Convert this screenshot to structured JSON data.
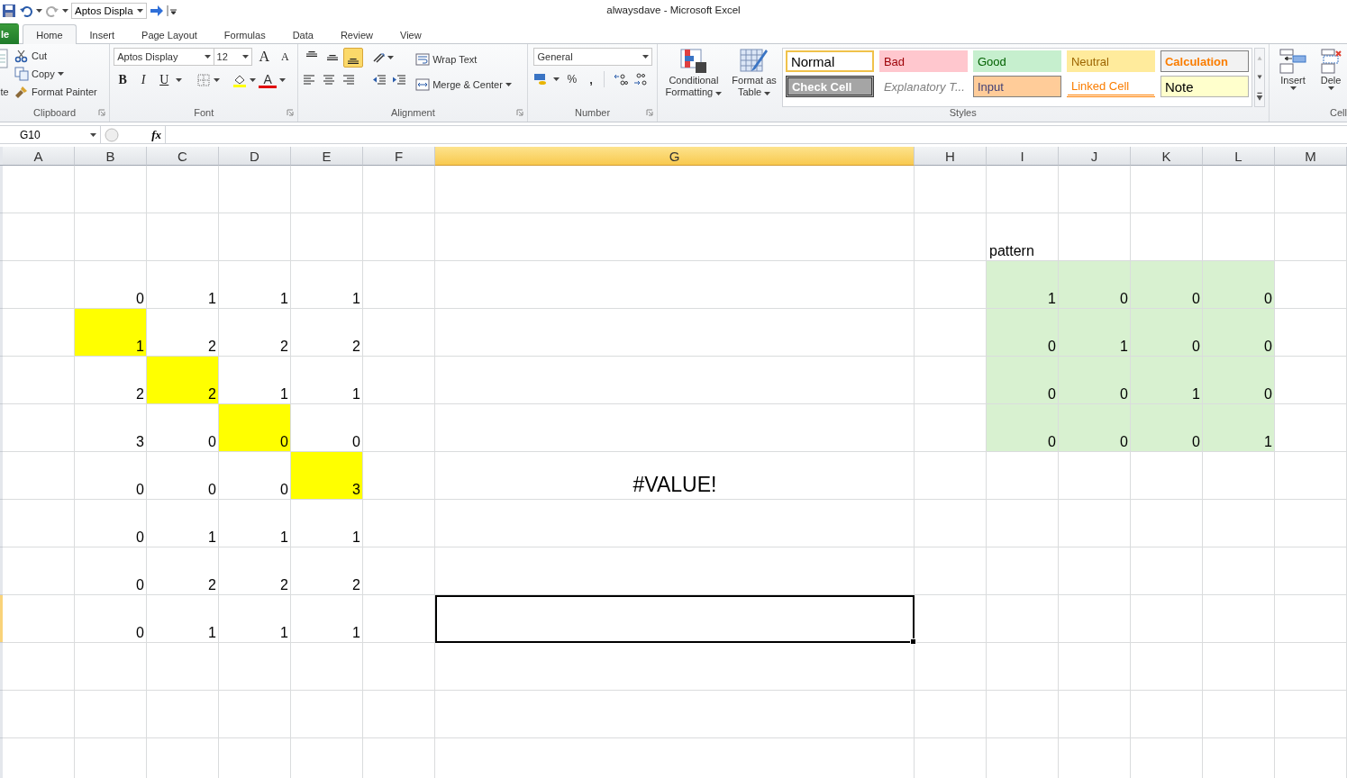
{
  "quick_access": {
    "font_name": "Aptos Displa"
  },
  "window": {
    "title": "alwaysdave  -  Microsoft Excel"
  },
  "tabs": [
    {
      "label": "le",
      "kind": "file",
      "selected": false
    },
    {
      "label": "Home",
      "kind": "tab",
      "selected": true
    },
    {
      "label": "Insert",
      "kind": "tab",
      "selected": false
    },
    {
      "label": "Page Layout",
      "kind": "tab",
      "selected": false
    },
    {
      "label": "Formulas",
      "kind": "tab",
      "selected": false
    },
    {
      "label": "Data",
      "kind": "tab",
      "selected": false
    },
    {
      "label": "Review",
      "kind": "tab",
      "selected": false
    },
    {
      "label": "View",
      "kind": "tab",
      "selected": false
    }
  ],
  "ribbon": {
    "clipboard": {
      "paste": "te",
      "cut": "Cut",
      "copy": "Copy",
      "format_painter": "Format Painter",
      "label": "Clipboard"
    },
    "font": {
      "name": "Aptos Display",
      "size": "12",
      "grow": "A",
      "shrink": "A",
      "bold": "B",
      "italic": "I",
      "underline": "U",
      "font_color": "A",
      "label": "Font"
    },
    "alignment": {
      "vertical": [
        {
          "selected": false
        },
        {
          "selected": false
        },
        {
          "selected": true
        }
      ],
      "wrap_text": "Wrap Text",
      "merge_center": "Merge & Center",
      "label": "Alignment"
    },
    "number": {
      "format": "General",
      "percent": "%",
      "comma": ",",
      "label": "Number"
    },
    "styles": {
      "conditional_formatting": "Conditional Formatting",
      "format_as_table": "Format as Table",
      "label": "Styles",
      "gallery": [
        {
          "label": "Normal",
          "kind": "normal",
          "selected": true
        },
        {
          "label": "Bad",
          "kind": "bad",
          "selected": false
        },
        {
          "label": "Good",
          "kind": "good",
          "selected": false
        },
        {
          "label": "Neutral",
          "kind": "neutral",
          "selected": false
        },
        {
          "label": "Calculation",
          "kind": "calculation",
          "selected": false
        },
        {
          "label": "Check Cell",
          "kind": "check",
          "selected": false
        },
        {
          "label": "Explanatory T...",
          "kind": "explanatory",
          "selected": false
        },
        {
          "label": "Input",
          "kind": "input",
          "selected": false
        },
        {
          "label": "Linked Cell",
          "kind": "linked",
          "selected": false
        },
        {
          "label": "Note",
          "kind": "note",
          "selected": false
        }
      ]
    },
    "cells": {
      "insert": "Insert",
      "delete": "Dele",
      "label": "Cell"
    }
  },
  "formula_bar": {
    "name_box": "G10",
    "fx": "fx"
  },
  "sheet": {
    "columns": [
      {
        "label": "A",
        "selected": false
      },
      {
        "label": "B",
        "selected": false
      },
      {
        "label": "C",
        "selected": false
      },
      {
        "label": "D",
        "selected": false
      },
      {
        "label": "E",
        "selected": false
      },
      {
        "label": "F",
        "selected": false
      },
      {
        "label": "G",
        "selected": true
      },
      {
        "label": "H",
        "selected": false
      },
      {
        "label": "I",
        "selected": false
      },
      {
        "label": "J",
        "selected": false
      },
      {
        "label": "K",
        "selected": false
      },
      {
        "label": "L",
        "selected": false
      },
      {
        "label": "M",
        "selected": false
      }
    ],
    "rows": [
      {
        "selected": false,
        "cells": []
      },
      {
        "selected": false,
        "cells": [
          null,
          null,
          null,
          null,
          null,
          null,
          null,
          null,
          {
            "value": "pattern",
            "kind": "text",
            "selected": false
          }
        ]
      },
      {
        "selected": false,
        "cells": [
          null,
          {
            "value": "0",
            "kind": "number",
            "selected": false
          },
          {
            "value": "1",
            "kind": "number",
            "selected": false
          },
          {
            "value": "1",
            "kind": "number",
            "selected": false
          },
          {
            "value": "1",
            "kind": "number",
            "selected": false
          },
          null,
          null,
          null,
          {
            "value": "1",
            "kind": "number",
            "selected": false,
            "color": "#d8f1d0"
          },
          {
            "value": "0",
            "kind": "number",
            "selected": false,
            "color": "#d8f1d0"
          },
          {
            "value": "0",
            "kind": "number",
            "selected": false,
            "color": "#d8f1d0"
          },
          {
            "value": "0",
            "kind": "number",
            "selected": false,
            "color": "#d8f1d0"
          }
        ]
      },
      {
        "selected": false,
        "cells": [
          null,
          {
            "value": "1",
            "kind": "number",
            "selected": false,
            "color": "#ffff00"
          },
          {
            "value": "2",
            "kind": "number",
            "selected": false
          },
          {
            "value": "2",
            "kind": "number",
            "selected": false
          },
          {
            "value": "2",
            "kind": "number",
            "selected": false
          },
          null,
          null,
          null,
          {
            "value": "0",
            "kind": "number",
            "selected": false,
            "color": "#d8f1d0"
          },
          {
            "value": "1",
            "kind": "number",
            "selected": false,
            "color": "#d8f1d0"
          },
          {
            "value": "0",
            "kind": "number",
            "selected": false,
            "color": "#d8f1d0"
          },
          {
            "value": "0",
            "kind": "number",
            "selected": false,
            "color": "#d8f1d0"
          }
        ]
      },
      {
        "selected": false,
        "cells": [
          null,
          {
            "value": "2",
            "kind": "number",
            "selected": false
          },
          {
            "value": "2",
            "kind": "number",
            "selected": false,
            "color": "#ffff00"
          },
          {
            "value": "1",
            "kind": "number",
            "selected": false
          },
          {
            "value": "1",
            "kind": "number",
            "selected": false
          },
          null,
          null,
          null,
          {
            "value": "0",
            "kind": "number",
            "selected": false,
            "color": "#d8f1d0"
          },
          {
            "value": "0",
            "kind": "number",
            "selected": false,
            "color": "#d8f1d0"
          },
          {
            "value": "1",
            "kind": "number",
            "selected": false,
            "color": "#d8f1d0"
          },
          {
            "value": "0",
            "kind": "number",
            "selected": false,
            "color": "#d8f1d0"
          }
        ]
      },
      {
        "selected": false,
        "cells": [
          null,
          {
            "value": "3",
            "kind": "number",
            "selected": false
          },
          {
            "value": "0",
            "kind": "number",
            "selected": false
          },
          {
            "value": "0",
            "kind": "number",
            "selected": false,
            "color": "#ffff00"
          },
          {
            "value": "0",
            "kind": "number",
            "selected": false
          },
          null,
          null,
          null,
          {
            "value": "0",
            "kind": "number",
            "selected": false,
            "color": "#d8f1d0"
          },
          {
            "value": "0",
            "kind": "number",
            "selected": false,
            "color": "#d8f1d0"
          },
          {
            "value": "0",
            "kind": "number",
            "selected": false,
            "color": "#d8f1d0"
          },
          {
            "value": "1",
            "kind": "number",
            "selected": false,
            "color": "#d8f1d0"
          }
        ]
      },
      {
        "selected": false,
        "cells": [
          null,
          {
            "value": "0",
            "kind": "number",
            "selected": false
          },
          {
            "value": "0",
            "kind": "number",
            "selected": false
          },
          {
            "value": "0",
            "kind": "number",
            "selected": false
          },
          {
            "value": "3",
            "kind": "number",
            "selected": false,
            "color": "#ffff00"
          },
          null,
          {
            "value": "#VALUE!",
            "kind": "error",
            "selected": false
          }
        ]
      },
      {
        "selected": false,
        "cells": [
          null,
          {
            "value": "0",
            "kind": "number",
            "selected": false
          },
          {
            "value": "1",
            "kind": "number",
            "selected": false
          },
          {
            "value": "1",
            "kind": "number",
            "selected": false
          },
          {
            "value": "1",
            "kind": "number",
            "selected": false
          }
        ]
      },
      {
        "selected": false,
        "cells": [
          null,
          {
            "value": "0",
            "kind": "number",
            "selected": false
          },
          {
            "value": "2",
            "kind": "number",
            "selected": false
          },
          {
            "value": "2",
            "kind": "number",
            "selected": false
          },
          {
            "value": "2",
            "kind": "number",
            "selected": false
          }
        ]
      },
      {
        "selected": true,
        "cells": [
          null,
          {
            "value": "0",
            "kind": "number",
            "selected": false
          },
          {
            "value": "1",
            "kind": "number",
            "selected": false
          },
          {
            "value": "1",
            "kind": "number",
            "selected": false
          },
          {
            "value": "1",
            "kind": "number",
            "selected": false
          },
          null,
          {
            "selected": true
          }
        ]
      },
      {
        "selected": false,
        "cells": []
      },
      {
        "selected": false,
        "cells": []
      },
      {
        "selected": false,
        "cells": []
      }
    ]
  }
}
